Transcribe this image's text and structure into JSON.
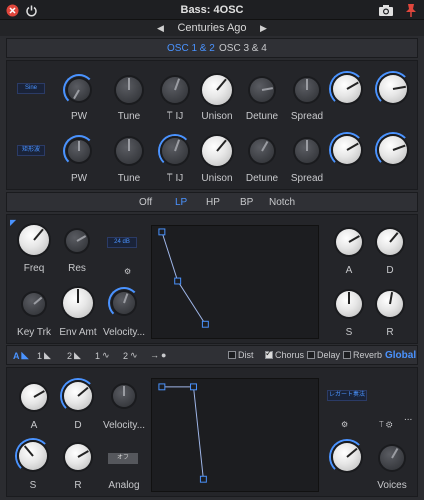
{
  "window": {
    "title": "Bass: 4OSC"
  },
  "preset": {
    "name": "Centuries Ago",
    "prev_icon": "triangle-left-icon",
    "next_icon": "triangle-right-icon"
  },
  "osc_tabs": [
    "OSC 1 & 2",
    "OSC 3 & 4"
  ],
  "osc_rows": [
    {
      "wave": "Sine",
      "labels": [
        "PW",
        "Tune",
        "⟙ IJ",
        "Unison",
        "Detune",
        "Spread"
      ]
    },
    {
      "wave": "矩形波",
      "labels": [
        "PW",
        "Tune",
        "⟙ IJ",
        "Unison",
        "Detune",
        "Spread"
      ]
    }
  ],
  "filter_tabs": [
    "Off",
    "LP",
    "HP",
    "BP",
    "Notch"
  ],
  "filter": {
    "slope": "24 dB",
    "labels": [
      "Freq",
      "Res",
      "Key Trk",
      "Env Amt",
      "Velocity..."
    ],
    "adsr_labels": [
      "A",
      "D",
      "S",
      "R"
    ]
  },
  "fx": {
    "sources": [
      "A",
      "1",
      "2",
      "1",
      "2",
      "→"
    ],
    "checks": [
      {
        "label": "Dist",
        "checked": false
      },
      {
        "label": "Chorus",
        "checked": true
      },
      {
        "label": "Delay",
        "checked": false
      },
      {
        "label": "Reverb",
        "checked": false
      }
    ],
    "global": "Global"
  },
  "amp": {
    "labels": [
      "A",
      "D",
      "Velocity...",
      "S",
      "R",
      "Analog"
    ],
    "analog_value": "オフ",
    "voice_badge": "レガート奏法",
    "voices_label": "Voices",
    "more": "..."
  }
}
